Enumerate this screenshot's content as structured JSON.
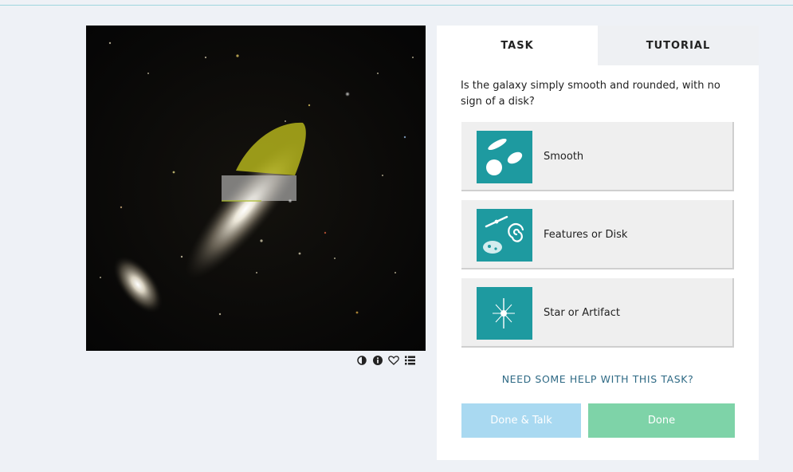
{
  "subject": {
    "tools": [
      {
        "name": "invert-icon"
      },
      {
        "name": "info-icon"
      },
      {
        "name": "heart-icon"
      },
      {
        "name": "collections-icon"
      }
    ]
  },
  "tabs": {
    "task": "TASK",
    "tutorial": "TUTORIAL"
  },
  "question": "Is the galaxy simply smooth and rounded, with no sign of a disk?",
  "answers": [
    {
      "label": "Smooth",
      "icon": "smooth-icon"
    },
    {
      "label": "Features or Disk",
      "icon": "features-disk-icon"
    },
    {
      "label": "Star or Artifact",
      "icon": "star-artifact-icon"
    }
  ],
  "help_link": "NEED SOME HELP WITH THIS TASK?",
  "buttons": {
    "done_talk": "Done & Talk",
    "done": "Done"
  },
  "colors": {
    "accent_teal": "#1e9aa0",
    "talk_button": "#a9d9f1",
    "done_button": "#7ed3a8",
    "help_link": "#2f6a85",
    "highlight": "#c8c81e"
  }
}
